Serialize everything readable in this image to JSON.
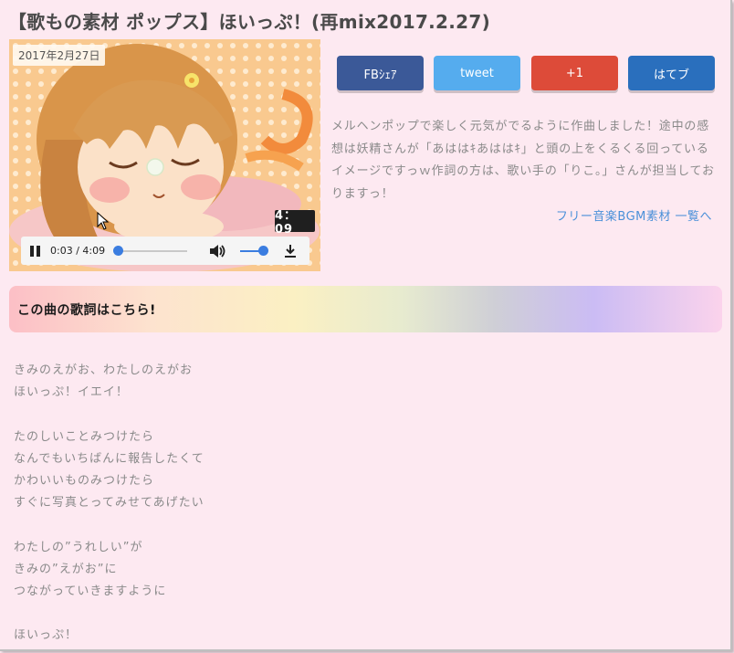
{
  "page": {
    "title": "【歌もの素材 ポップス】ほいっぷ！(再mix2017.2.27)"
  },
  "media": {
    "date": "2017年2月27日",
    "duration": "4：09",
    "thumbnail_icon": "anime-girl-sleeping-illustration",
    "player": {
      "time": "0:03 / 4:09",
      "progress": 0.012,
      "volume": 0.72,
      "accent_color": "#3b7de0"
    }
  },
  "share": {
    "buttons": [
      {
        "label": "FBｼｪｱ",
        "color": "#3b5998"
      },
      {
        "label": "tweet",
        "color": "#55acee"
      },
      {
        "label": "+1",
        "color": "#dd4b39"
      },
      {
        "label": "はてブ",
        "color": "#2a6fbd"
      }
    ]
  },
  "description": {
    "text": "メルヘンポップで楽しく元気がでるように作曲しました！途中の感想は妖精さんが「あははｷあははｷ」と頭の上をくるくる回っているイメージですっｗ作詞の方は、歌い手の「りこ。」さんが担当しておりますっ！",
    "list_link": "フリー音楽BGM素材 一覧へ"
  },
  "lyrics": {
    "heading": "この曲の歌詞はこちら!",
    "lines": [
      "きみのえがお、わたしのえがお",
      "ほいっぷ！イエイ！",
      "",
      "たのしいことみつけたら",
      "なんでもいちばんに報告したくて",
      "かわいいものみつけたら",
      "すぐに写真とってみせてあげたい",
      "",
      "わたしの”うれしい”が",
      "きみの”えがお”に",
      "つながっていきますように",
      "",
      "ほいっぷ！"
    ]
  },
  "colors": {
    "background": "#fde9f1",
    "link": "#4a90d9"
  }
}
